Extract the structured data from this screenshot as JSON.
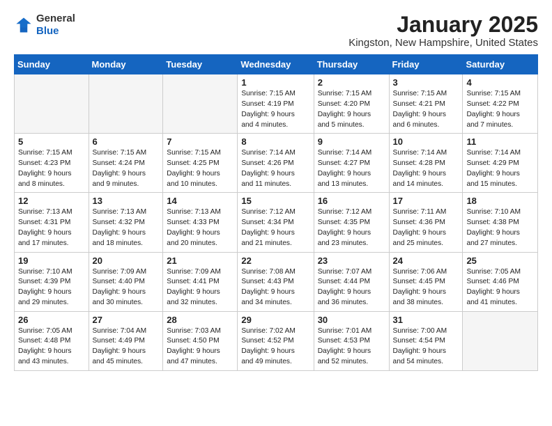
{
  "header": {
    "logo_general": "General",
    "logo_blue": "Blue",
    "month_title": "January 2025",
    "location": "Kingston, New Hampshire, United States"
  },
  "weekdays": [
    "Sunday",
    "Monday",
    "Tuesday",
    "Wednesday",
    "Thursday",
    "Friday",
    "Saturday"
  ],
  "weeks": [
    [
      {
        "day": "",
        "info": ""
      },
      {
        "day": "",
        "info": ""
      },
      {
        "day": "",
        "info": ""
      },
      {
        "day": "1",
        "info": "Sunrise: 7:15 AM\nSunset: 4:19 PM\nDaylight: 9 hours\nand 4 minutes."
      },
      {
        "day": "2",
        "info": "Sunrise: 7:15 AM\nSunset: 4:20 PM\nDaylight: 9 hours\nand 5 minutes."
      },
      {
        "day": "3",
        "info": "Sunrise: 7:15 AM\nSunset: 4:21 PM\nDaylight: 9 hours\nand 6 minutes."
      },
      {
        "day": "4",
        "info": "Sunrise: 7:15 AM\nSunset: 4:22 PM\nDaylight: 9 hours\nand 7 minutes."
      }
    ],
    [
      {
        "day": "5",
        "info": "Sunrise: 7:15 AM\nSunset: 4:23 PM\nDaylight: 9 hours\nand 8 minutes."
      },
      {
        "day": "6",
        "info": "Sunrise: 7:15 AM\nSunset: 4:24 PM\nDaylight: 9 hours\nand 9 minutes."
      },
      {
        "day": "7",
        "info": "Sunrise: 7:15 AM\nSunset: 4:25 PM\nDaylight: 9 hours\nand 10 minutes."
      },
      {
        "day": "8",
        "info": "Sunrise: 7:14 AM\nSunset: 4:26 PM\nDaylight: 9 hours\nand 11 minutes."
      },
      {
        "day": "9",
        "info": "Sunrise: 7:14 AM\nSunset: 4:27 PM\nDaylight: 9 hours\nand 13 minutes."
      },
      {
        "day": "10",
        "info": "Sunrise: 7:14 AM\nSunset: 4:28 PM\nDaylight: 9 hours\nand 14 minutes."
      },
      {
        "day": "11",
        "info": "Sunrise: 7:14 AM\nSunset: 4:29 PM\nDaylight: 9 hours\nand 15 minutes."
      }
    ],
    [
      {
        "day": "12",
        "info": "Sunrise: 7:13 AM\nSunset: 4:31 PM\nDaylight: 9 hours\nand 17 minutes."
      },
      {
        "day": "13",
        "info": "Sunrise: 7:13 AM\nSunset: 4:32 PM\nDaylight: 9 hours\nand 18 minutes."
      },
      {
        "day": "14",
        "info": "Sunrise: 7:13 AM\nSunset: 4:33 PM\nDaylight: 9 hours\nand 20 minutes."
      },
      {
        "day": "15",
        "info": "Sunrise: 7:12 AM\nSunset: 4:34 PM\nDaylight: 9 hours\nand 21 minutes."
      },
      {
        "day": "16",
        "info": "Sunrise: 7:12 AM\nSunset: 4:35 PM\nDaylight: 9 hours\nand 23 minutes."
      },
      {
        "day": "17",
        "info": "Sunrise: 7:11 AM\nSunset: 4:36 PM\nDaylight: 9 hours\nand 25 minutes."
      },
      {
        "day": "18",
        "info": "Sunrise: 7:10 AM\nSunset: 4:38 PM\nDaylight: 9 hours\nand 27 minutes."
      }
    ],
    [
      {
        "day": "19",
        "info": "Sunrise: 7:10 AM\nSunset: 4:39 PM\nDaylight: 9 hours\nand 29 minutes."
      },
      {
        "day": "20",
        "info": "Sunrise: 7:09 AM\nSunset: 4:40 PM\nDaylight: 9 hours\nand 30 minutes."
      },
      {
        "day": "21",
        "info": "Sunrise: 7:09 AM\nSunset: 4:41 PM\nDaylight: 9 hours\nand 32 minutes."
      },
      {
        "day": "22",
        "info": "Sunrise: 7:08 AM\nSunset: 4:43 PM\nDaylight: 9 hours\nand 34 minutes."
      },
      {
        "day": "23",
        "info": "Sunrise: 7:07 AM\nSunset: 4:44 PM\nDaylight: 9 hours\nand 36 minutes."
      },
      {
        "day": "24",
        "info": "Sunrise: 7:06 AM\nSunset: 4:45 PM\nDaylight: 9 hours\nand 38 minutes."
      },
      {
        "day": "25",
        "info": "Sunrise: 7:05 AM\nSunset: 4:46 PM\nDaylight: 9 hours\nand 41 minutes."
      }
    ],
    [
      {
        "day": "26",
        "info": "Sunrise: 7:05 AM\nSunset: 4:48 PM\nDaylight: 9 hours\nand 43 minutes."
      },
      {
        "day": "27",
        "info": "Sunrise: 7:04 AM\nSunset: 4:49 PM\nDaylight: 9 hours\nand 45 minutes."
      },
      {
        "day": "28",
        "info": "Sunrise: 7:03 AM\nSunset: 4:50 PM\nDaylight: 9 hours\nand 47 minutes."
      },
      {
        "day": "29",
        "info": "Sunrise: 7:02 AM\nSunset: 4:52 PM\nDaylight: 9 hours\nand 49 minutes."
      },
      {
        "day": "30",
        "info": "Sunrise: 7:01 AM\nSunset: 4:53 PM\nDaylight: 9 hours\nand 52 minutes."
      },
      {
        "day": "31",
        "info": "Sunrise: 7:00 AM\nSunset: 4:54 PM\nDaylight: 9 hours\nand 54 minutes."
      },
      {
        "day": "",
        "info": ""
      }
    ]
  ]
}
